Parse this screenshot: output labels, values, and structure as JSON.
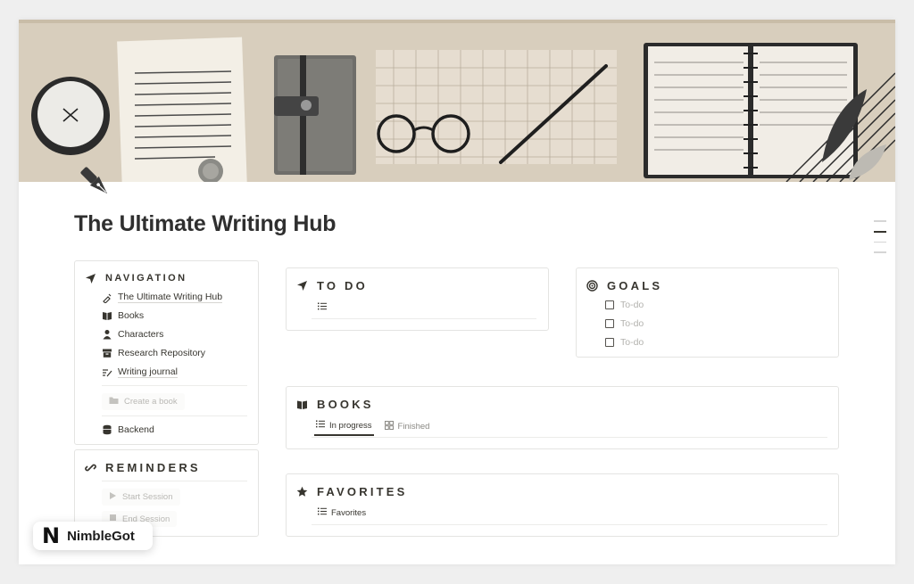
{
  "page": {
    "title": "The Ultimate Writing Hub"
  },
  "navigation": {
    "heading": "NAVIGATION",
    "items": [
      {
        "label": "The Ultimate Writing Hub",
        "icon": "pen-nib-icon"
      },
      {
        "label": "Books",
        "icon": "open-book-icon"
      },
      {
        "label": "Characters",
        "icon": "person-icon"
      },
      {
        "label": "Research Repository",
        "icon": "archive-icon"
      },
      {
        "label": "Writing journal",
        "icon": "journal-pen-icon"
      }
    ],
    "create_label": "Create a book",
    "backend_label": "Backend"
  },
  "reminders": {
    "heading": "REMINDERS",
    "start_label": "Start Session",
    "end_label": "End Session"
  },
  "todo": {
    "heading": "TO DO"
  },
  "goals": {
    "heading": "GOALS",
    "items": [
      "To-do",
      "To-do",
      "To-do"
    ]
  },
  "books": {
    "heading": "BOOKS",
    "tabs": [
      {
        "label": "In progress",
        "active": true
      },
      {
        "label": "Finished",
        "active": false
      }
    ]
  },
  "favorites": {
    "heading": "FAVORITES",
    "tab_label": "Favorites"
  },
  "brand": {
    "logo": "N",
    "name": "NimbleGot"
  },
  "colors": {
    "text": "#37352f",
    "muted": "#b3b2ae",
    "cover": "#d8cebd",
    "border": "#e4e4e2"
  }
}
